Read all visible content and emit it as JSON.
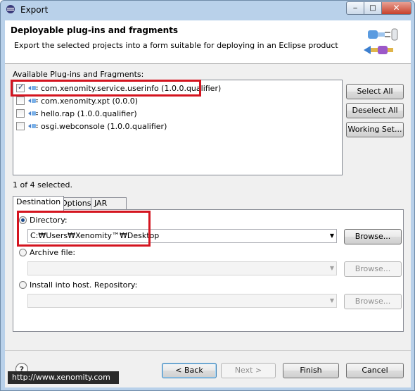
{
  "window": {
    "title": "Export",
    "minimize": "‒",
    "maximize": "□",
    "close": "✕"
  },
  "header": {
    "title": "Deployable plug-ins and fragments",
    "description": "Export the selected projects into a form suitable for deploying in an Eclipse product"
  },
  "plugins": {
    "label": "Available Plug-ins and Fragments:",
    "items": [
      {
        "label": "com.xenomity.service.userinfo (1.0.0.qualifier)",
        "checked": true
      },
      {
        "label": "com.xenomity.xpt (0.0.0)",
        "checked": false
      },
      {
        "label": "hello.rap (1.0.0.qualifier)",
        "checked": false
      },
      {
        "label": "osgi.webconsole (1.0.0.qualifier)",
        "checked": false
      }
    ],
    "selected_count": "1 of 4 selected."
  },
  "side_buttons": {
    "select_all": "Select All",
    "deselect_all": "Deselect All",
    "working_set": "Working Set..."
  },
  "tabs": [
    "Destination",
    "Options",
    "JAR Signing"
  ],
  "destination": {
    "directory_label": "Directory:",
    "directory_value": "C:₩Users₩Xenomity™₩Desktop",
    "archive_label": "Archive file:",
    "archive_value": "",
    "install_label": "Install into host. Repository:",
    "install_value": "",
    "browse": "Browse..."
  },
  "footer": {
    "back": "< Back",
    "next": "Next >",
    "finish": "Finish",
    "cancel": "Cancel",
    "help": "?"
  },
  "watermark": "http://www.xenomity.com",
  "colors": {
    "highlight": "#d4141f",
    "title_bar": "#b9d1ea"
  }
}
